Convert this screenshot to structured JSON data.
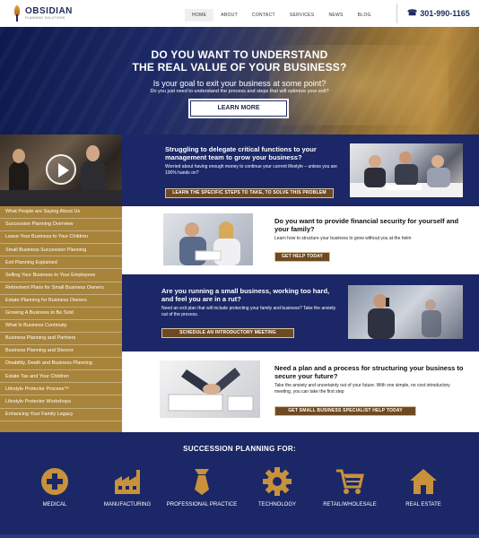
{
  "brand": {
    "name": "OBSIDIAN",
    "sub": "PLANNING SOLUTIONS"
  },
  "nav": [
    {
      "label": "HOME"
    },
    {
      "label": "ABOUT"
    },
    {
      "label": "CONTACT"
    },
    {
      "label": "SERVICES"
    },
    {
      "label": "NEWS"
    },
    {
      "label": "BLOG"
    }
  ],
  "phone": "301-990-1165",
  "hero": {
    "title_line1": "DO YOU WANT TO UNDERSTAND",
    "title_line2": "THE REAL VALUE OF YOUR BUSINESS?",
    "subtitle": "Is your goal to exit your business at some point?",
    "subtitle2": "Do you just need to understand the process and steps that will optimize your exit?",
    "button": "LEARN MORE"
  },
  "sidebar": [
    "What People are Saying About Us",
    "Succession Planning Overview",
    "Leave Your Business to Your Children",
    "Small Business Succession Planning",
    "Exit Planning Explained",
    "Selling Your Business to Your Employees",
    "Retirement Plans for Small Business Owners",
    "Estate Planning for Business Owners",
    "Growing A Business to Be Sold",
    "What Is Business Continuity",
    "Business Planning and Partners",
    "Business Planning and Divorce",
    "Disability, Death and Business Planning",
    "Estate Tax and Your Children",
    "Lifestyle Protector Process™",
    "Lifestyle Protector Workshops",
    "Enhancing Your Family Legacy"
  ],
  "sections": [
    {
      "title": "Struggling to delegate critical functions to your management team to grow your business?",
      "body": "Worried about having enough money to continue your current lifestyle – unless you are 100% hands on?",
      "button": "LEARN THE SPECIFIC STEPS TO TAKE, TO SOLVE THIS PROBLEM"
    },
    {
      "title": "Do you want to provide financial security for yourself and your family?",
      "body": "Learn how to structure your business to grow without you at the helm",
      "button": "GET HELP TODAY"
    },
    {
      "title": "Are you running a small business, working too hard, and feel you are in a rut?",
      "body": "Need an exit plan that will include protecting your family and business? Take the anxiety out of the process.",
      "button": "SCHEDULE AN INTRODUCTORY MEETING"
    },
    {
      "title": "Need a plan and a process for structuring your business to secure your future?",
      "body": "Take the anxiety and uncertainty out of your future. With one simple, no cost introductory meeting, you can take the first step",
      "button": "GET SMALL BUSINESS SPECIALIST HELP TODAY"
    }
  ],
  "industries": {
    "title": "SUCCESSION PLANNING FOR:",
    "items": [
      {
        "label": "MEDICAL",
        "icon": "medical-icon"
      },
      {
        "label": "MANUFACTURING",
        "icon": "factory-icon"
      },
      {
        "label": "PROFESSIONAL PRACTICE",
        "icon": "tie-icon"
      },
      {
        "label": "TECHNOLOGY",
        "icon": "gear-icon"
      },
      {
        "label": "RETAIL/WHOLESALE",
        "icon": "cart-icon"
      },
      {
        "label": "REAL ESTATE",
        "icon": "house-icon"
      }
    ]
  },
  "colors": {
    "navy": "#1b2766",
    "gold": "#a8833a",
    "button_brown": "#6e4a22",
    "icon_gold": "#c8913c"
  }
}
